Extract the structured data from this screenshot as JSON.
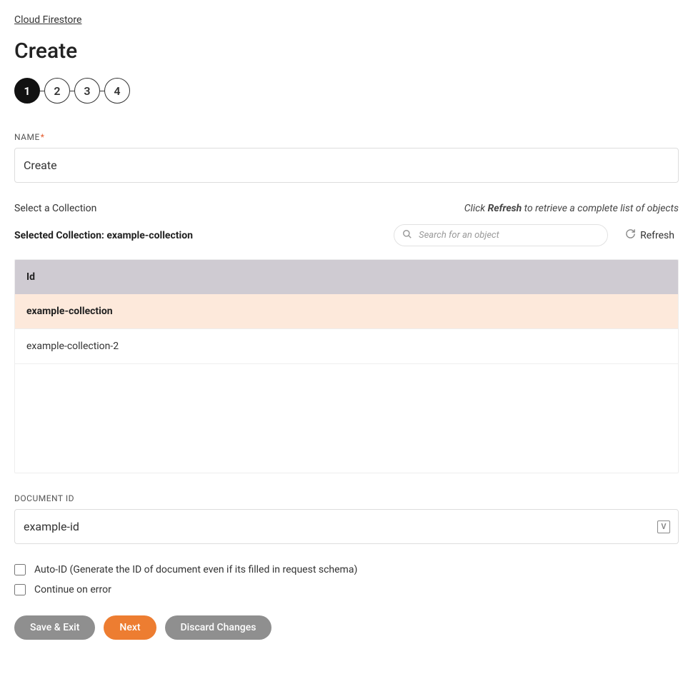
{
  "breadcrumb": "Cloud Firestore",
  "page_title": "Create",
  "stepper": {
    "steps": [
      "1",
      "2",
      "3",
      "4"
    ],
    "active_index": 0
  },
  "name_field": {
    "label": "NAME",
    "value": "Create"
  },
  "collection": {
    "select_label": "Select a Collection",
    "hint_prefix": "Click ",
    "hint_bold": "Refresh",
    "hint_suffix": " to retrieve a complete list of objects",
    "selected_prefix": "Selected Collection: ",
    "selected_value": "example-collection",
    "search_placeholder": "Search for an object",
    "refresh_label": "Refresh",
    "header": "Id",
    "rows": [
      {
        "id": "example-collection",
        "selected": true
      },
      {
        "id": "example-collection-2",
        "selected": false
      }
    ]
  },
  "document_id": {
    "label": "DOCUMENT ID",
    "value": "example-id",
    "badge": "V"
  },
  "checkboxes": {
    "auto_id": "Auto-ID (Generate the ID of document even if its filled in request schema)",
    "continue_on_error": "Continue on error"
  },
  "buttons": {
    "save_exit": "Save & Exit",
    "next": "Next",
    "discard": "Discard Changes"
  }
}
